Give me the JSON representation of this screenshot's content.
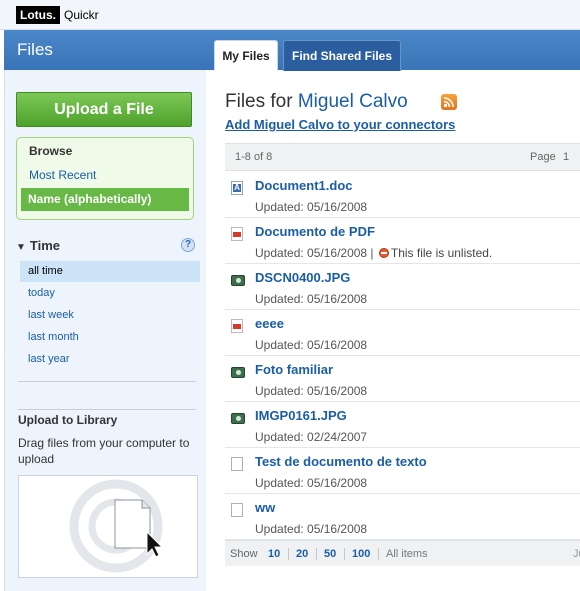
{
  "brand": {
    "name": "Lotus.",
    "product": "Quickr"
  },
  "header": {
    "title": "Files"
  },
  "tabs": [
    {
      "label": "My Files",
      "active": true
    },
    {
      "label": "Find Shared Files",
      "active": false
    }
  ],
  "sidebar": {
    "upload_button": "Upload a File",
    "browse": {
      "title": "Browse",
      "items": [
        {
          "label": "Most Recent",
          "selected": false
        },
        {
          "label": "Name (alphabetically)",
          "selected": true
        }
      ]
    },
    "time": {
      "title": "Time",
      "help": "?",
      "items": [
        {
          "label": "all time",
          "selected": true
        },
        {
          "label": "today"
        },
        {
          "label": "last week"
        },
        {
          "label": "last month"
        },
        {
          "label": "last year"
        }
      ]
    },
    "upload_library": {
      "title": "Upload to Library",
      "description": "Drag files from your computer to upload"
    }
  },
  "main": {
    "title_prefix": "Files for",
    "owner": "Miguel Calvo",
    "connect_link": "Add Miguel Calvo to your connectors",
    "pager": {
      "count": "1-8 of 8",
      "page_label": "Page",
      "page_number": "1"
    },
    "files": [
      {
        "name": "Document1.doc",
        "icon": "word-doc-icon",
        "updated": "Updated: 05/16/2008",
        "note": ""
      },
      {
        "name": "Documento de PDF",
        "icon": "pdf-icon",
        "updated": "Updated: 05/16/2008 |",
        "note": "This file is unlisted."
      },
      {
        "name": "DSCN0400.JPG",
        "icon": "image-icon",
        "updated": "Updated: 05/16/2008",
        "note": ""
      },
      {
        "name": "eeee",
        "icon": "pdf-icon",
        "updated": "Updated: 05/16/2008",
        "note": ""
      },
      {
        "name": "Foto familiar",
        "icon": "image-icon",
        "updated": "Updated: 05/16/2008",
        "note": ""
      },
      {
        "name": "IMGP0161.JPG",
        "icon": "image-icon",
        "updated": "Updated: 02/24/2007",
        "note": ""
      },
      {
        "name": "Test de documento de texto",
        "icon": "text-file-icon",
        "updated": "Updated: 05/16/2008",
        "note": ""
      },
      {
        "name": "ww",
        "icon": "text-file-icon",
        "updated": "Updated: 05/16/2008",
        "note": ""
      }
    ],
    "show_bar": {
      "label": "Show",
      "options": [
        "10",
        "20",
        "50",
        "100"
      ],
      "all": "All items",
      "next": "Ju"
    }
  },
  "colors": {
    "header_band": "#3a74b8",
    "link": "#1a5da8",
    "upload_button": "#4ea22c",
    "browse_selected": "#67b844"
  }
}
